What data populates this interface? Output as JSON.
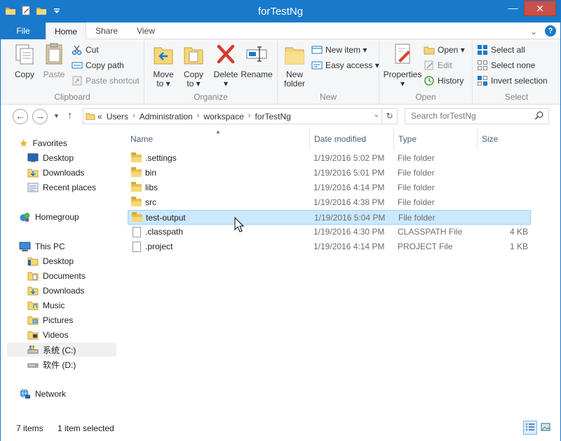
{
  "window": {
    "title": "forTestNg"
  },
  "titlebar": {
    "min_glyph": "—",
    "max_glyph": "☐",
    "close_glyph": "✕"
  },
  "tabs": {
    "file": "File",
    "home": "Home",
    "share": "Share",
    "view": "View"
  },
  "ribbon": {
    "clipboard": {
      "label": "Clipboard",
      "copy": "Copy",
      "paste": "Paste",
      "cut": "Cut",
      "copy_path": "Copy path",
      "paste_shortcut": "Paste shortcut"
    },
    "organize": {
      "label": "Organize",
      "move_to": "Move",
      "move_to_2": "to ▾",
      "copy_to": "Copy",
      "copy_to_2": "to ▾",
      "delete": "Delete",
      "delete_2": "▾",
      "rename": "Rename"
    },
    "new": {
      "label": "New",
      "new_folder": "New",
      "new_folder_2": "folder",
      "new_item": "New item ▾",
      "easy_access": "Easy access ▾"
    },
    "open": {
      "label": "Open",
      "properties": "Properties",
      "properties_2": "▾",
      "open": "Open ▾",
      "edit": "Edit",
      "history": "History"
    },
    "select": {
      "label": "Select",
      "select_all": "Select all",
      "select_none": "Select none",
      "invert_selection": "Invert selection"
    }
  },
  "address": {
    "overflow": "«",
    "crumbs": [
      "Users",
      "Administration",
      "workspace",
      "forTestNg"
    ],
    "search_placeholder": "Search forTestNg"
  },
  "navpane": {
    "favorites": "Favorites",
    "fav_items": [
      "Desktop",
      "Downloads",
      "Recent places"
    ],
    "homegroup": "Homegroup",
    "this_pc": "This PC",
    "pc_items": [
      "Desktop",
      "Documents",
      "Downloads",
      "Music",
      "Pictures",
      "Videos",
      "系统 (C:)",
      "软件 (D:)"
    ],
    "network": "Network"
  },
  "columns": {
    "name": "Name",
    "date": "Date modified",
    "type": "Type",
    "size": "Size"
  },
  "files": [
    {
      "name": ".settings",
      "date": "1/19/2016 5:02 PM",
      "type": "File folder",
      "size": "",
      "kind": "folder"
    },
    {
      "name": "bin",
      "date": "1/19/2016 5:01 PM",
      "type": "File folder",
      "size": "",
      "kind": "folder"
    },
    {
      "name": "libs",
      "date": "1/19/2016 4:14 PM",
      "type": "File folder",
      "size": "",
      "kind": "folder"
    },
    {
      "name": "src",
      "date": "1/19/2016 4:38 PM",
      "type": "File folder",
      "size": "",
      "kind": "folder"
    },
    {
      "name": "test-output",
      "date": "1/19/2016 5:04 PM",
      "type": "File folder",
      "size": "",
      "kind": "folder",
      "selected": true
    },
    {
      "name": ".classpath",
      "date": "1/19/2016 4:30 PM",
      "type": "CLASSPATH File",
      "size": "4 KB",
      "kind": "file"
    },
    {
      "name": ".project",
      "date": "1/19/2016 4:14 PM",
      "type": "PROJECT File",
      "size": "1 KB",
      "kind": "file"
    }
  ],
  "status": {
    "items": "7 items",
    "selected": "1 item selected"
  },
  "colors": {
    "accent": "#1979ca",
    "selection": "#cce8ff",
    "close": "#c7504b"
  }
}
